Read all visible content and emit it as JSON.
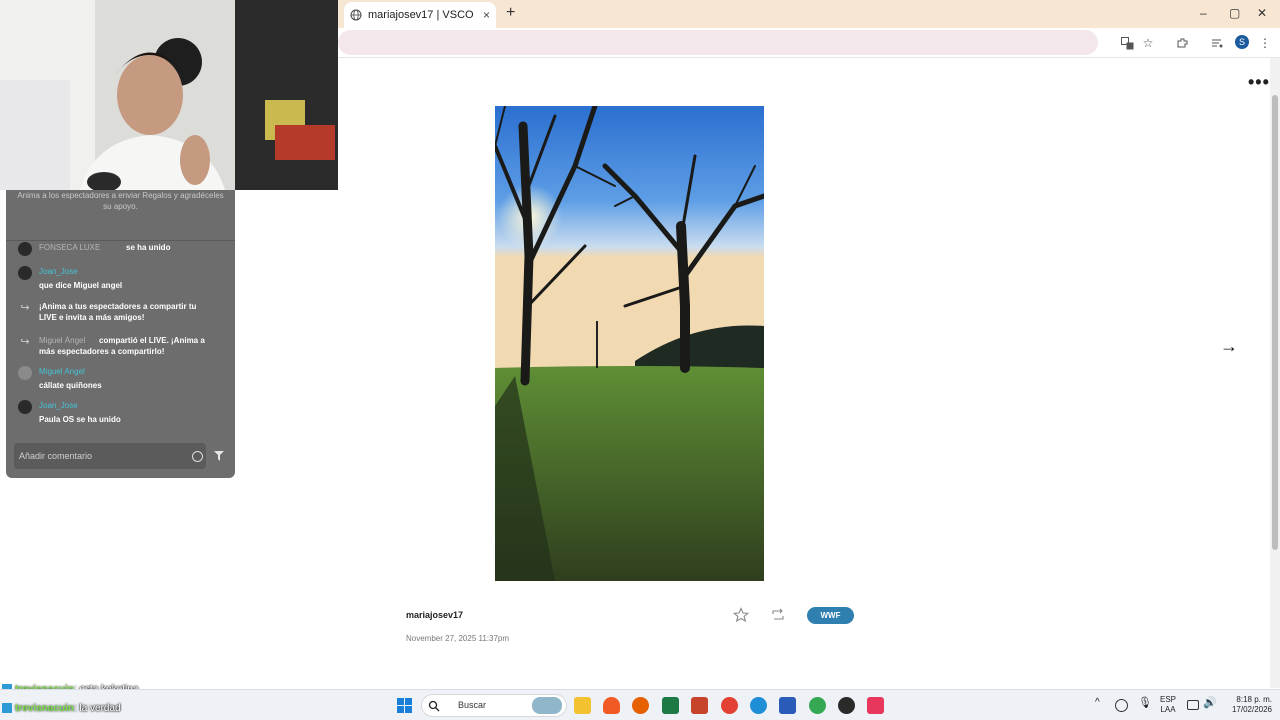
{
  "browser": {
    "tab_title": "mariajosev17 | VSCO",
    "tab_close": "×",
    "new_tab": "+",
    "window_controls": [
      "–",
      "▢",
      "✕"
    ],
    "toolbar_icons": [
      "translate-icon",
      "star-icon",
      "extensions-icon",
      "media-icon",
      "profile-avatar",
      "menu-icon"
    ],
    "profile_initial": "S"
  },
  "page": {
    "more_menu": "•••",
    "next_arrow": "→",
    "username": "mariajosev17",
    "date": "November 27, 2025  11:37pm",
    "badge": "WWF"
  },
  "live_chat": {
    "tip": "Anima a los espectadores a enviar Regalos y agradéceles su apoyo.",
    "messages": [
      {
        "name": "FONSECA  LUXE",
        "text": "se ha unido"
      },
      {
        "name": "Joan_Jose",
        "text": "que dice Miguel angel"
      },
      {
        "text1": "¡Anima a tus espectadores a compartir tu",
        "text2": "LIVE e invita a más amigos!"
      },
      {
        "name": "Miguel Ángel",
        "text1": "compartió el LIVE. ¡Anima a",
        "text2": "más espectadores a compartirlo!"
      },
      {
        "name": "Miguel Angel",
        "text": "cállate quiñones"
      },
      {
        "name": "Joan_Jose",
        "text": "Paula OS se ha unido"
      }
    ],
    "comment_placeholder": "Añadir comentario"
  },
  "stream_chat": [
    {
      "user": "trevisnacuin",
      "text": ": esta koketina"
    },
    {
      "user": "trevisnacuin",
      "text": ": la verdad"
    }
  ],
  "taskbar": {
    "search_label": "Buscar",
    "lang_top": "ESP",
    "lang_bottom": "LAA",
    "time": "8:18 p. m.",
    "date": "17/02/2026"
  },
  "colors": {
    "tab_bar": "#f7e6d2",
    "badge": "#2f7fb0",
    "chat_name": "#46c2d6",
    "stream_user": "#7ee04a"
  }
}
